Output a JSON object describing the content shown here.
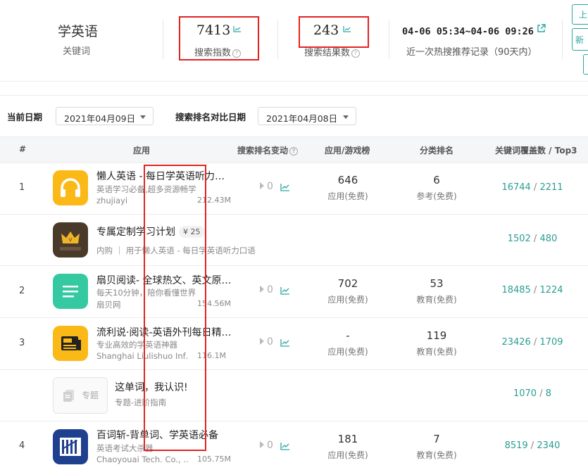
{
  "header": {
    "keyword": "学英语",
    "keyword_label": "关键词",
    "search_index_value": "7413",
    "search_index_label": "搜索指数",
    "search_results_value": "243",
    "search_results_label": "搜索结果数",
    "time_range": "04-06 05:34~04-06 09:26",
    "time_range_label": "近一次热搜推荐记录（90天内）",
    "side_button_1": "上",
    "side_button_2": "新"
  },
  "filters": {
    "current_date_label": "当前日期",
    "current_date_value": "2021年04月09日",
    "compare_date_label": "搜索排名对比日期",
    "compare_date_value": "2021年04月08日"
  },
  "table": {
    "headers": [
      "#",
      "应用",
      "搜索排名变动",
      "应用/游戏榜",
      "分类排名",
      "关键词覆盖数 / Top3"
    ],
    "rows": [
      {
        "rank": "1",
        "title": "懒人英语 - 每日学英语听力…",
        "subtitle": "英语学习必备,超多资源畅学",
        "developer": "zhujiayi",
        "size": "212.43M",
        "change": "0",
        "app_rank": "646",
        "app_rank_sub": "应用(免费)",
        "cat_rank": "6",
        "cat_rank_sub": "参考(免费)",
        "cov_a": "16744",
        "cov_b": "2211",
        "icon": "headphones-icon"
      },
      {
        "rank": "",
        "title": "专属定制学习计划",
        "price": "¥ 25",
        "subtitle": "内购 ｜ 用于懒人英语 - 每日学英语听力口语",
        "cov_a": "1502",
        "cov_b": "480",
        "icon": "crown-icon"
      },
      {
        "rank": "2",
        "title": "扇贝阅读- 全球热文、英文原…",
        "subtitle": "每天10分钟，陪你看懂世界",
        "developer": "扇贝网",
        "size": "154.56M",
        "change": "0",
        "app_rank": "702",
        "app_rank_sub": "应用(免费)",
        "cat_rank": "53",
        "cat_rank_sub": "教育(免费)",
        "cov_a": "18485",
        "cov_b": "1224",
        "icon": "list-lines-icon"
      },
      {
        "rank": "3",
        "title": "流利说·阅读-英语外刊每日精…",
        "subtitle": "专业高效的学英语神器",
        "developer": "Shanghai Liulishuo Inf…",
        "size": "116.1M",
        "change": "0",
        "app_rank": "-",
        "app_rank_sub": "应用(免费)",
        "cat_rank": "119",
        "cat_rank_sub": "教育(免费)",
        "cov_a": "23426",
        "cov_b": "1709",
        "icon": "newspaper-icon"
      },
      {
        "rank": "",
        "title": "这单词，我认识!",
        "subtitle": "专题-进阶指南",
        "topic_label": "专题",
        "cov_a": "1070",
        "cov_b": "8",
        "icon": "topic-icon"
      },
      {
        "rank": "4",
        "title": "百词斩-背单词、学英语必备",
        "subtitle": "英语考试大杀器",
        "developer": "Chaoyouai Tech. Co., …",
        "size": "105.75M",
        "change": "0",
        "app_rank": "181",
        "app_rank_sub": "应用(免费)",
        "cat_rank": "7",
        "cat_rank_sub": "教育(免费)",
        "cov_a": "8519",
        "cov_b": "2340",
        "icon": "bars-icon"
      }
    ]
  },
  "colors": {
    "accent": "#2aa6a1",
    "coverage": "#2a9d93",
    "highlight": "#e32222",
    "icon_yellow": "#fbb917",
    "icon_green": "#34c9a0",
    "icon_brown": "#4a3a2a",
    "icon_blue": "#1f3f8f"
  }
}
